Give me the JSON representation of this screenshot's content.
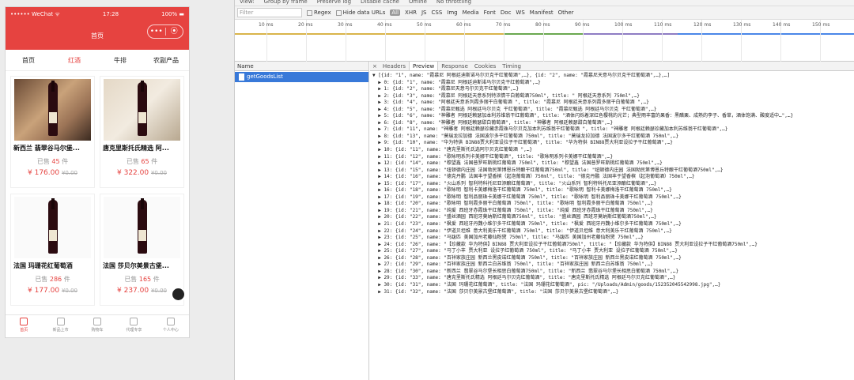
{
  "phone": {
    "status": {
      "carrier": "•••••• WeChat ᯤ",
      "time": "17:28",
      "battery": "100% ▬"
    },
    "title": "首页",
    "capsule": {
      "more": "•••",
      "close": "⦿"
    },
    "tabs": [
      "首页",
      "红酒",
      "牛排",
      "农副产品"
    ],
    "active_tab": 1,
    "products": [
      {
        "name": "新西兰 翡翠谷马尔堡...",
        "sold_prefix": "已售",
        "sold": "45",
        "sold_suffix": "件",
        "price": "¥ 176.00",
        "old": "¥0.00"
      },
      {
        "name": "唐克里斯托氏精选 阿...",
        "sold_prefix": "已售",
        "sold": "65",
        "sold_suffix": "件",
        "price": "¥ 322.00",
        "old": "¥0.00"
      },
      {
        "name": "法国 玛珊花红葡萄酒",
        "sold_prefix": "已售",
        "sold": "286",
        "sold_suffix": "件",
        "price": "¥ 177.00",
        "old": "¥0.00"
      },
      {
        "name": "法国 莎贝尔美景古堡...",
        "sold_prefix": "已售",
        "sold": "165",
        "sold_suffix": "件",
        "price": "¥ 237.00",
        "old": "¥0.00"
      }
    ],
    "tabbar": [
      "首页",
      "新品上市",
      "购物车",
      "代理专享",
      "个人中心"
    ]
  },
  "devtools": {
    "toolbar_top": [
      "View:",
      "Group by frame",
      "Preserve log",
      "Disable cache",
      "Offline",
      "No throttling"
    ],
    "filter_placeholder": "Filter",
    "filters": {
      "regex": "Regex",
      "hide": "Hide data URLs",
      "all": "All",
      "types": [
        "XHR",
        "JS",
        "CSS",
        "Img",
        "Media",
        "Font",
        "Doc",
        "WS",
        "Manifest",
        "Other"
      ]
    },
    "ticks": [
      "10 ms",
      "20 ms",
      "30 ms",
      "40 ms",
      "50 ms",
      "60 ms",
      "70 ms",
      "80 ms",
      "90 ms",
      "100 ms",
      "110 ms",
      "120 ms",
      "130 ms",
      "140 ms",
      "150 ms"
    ],
    "name_header": "Name",
    "request": "getGoodsList",
    "detail_tabs": [
      "×",
      "Headers",
      "Preview",
      "Response",
      "Cookies",
      "Timing"
    ],
    "active_detail": 2,
    "preview_lines": [
      "▼ [{id: \"1\", name: \"霞慕尼 阿根廷迪斯诺马尔贝克干红葡萄酒\",…}, {id: \"2\", name: \"霞慕尼天意马尔贝克干红葡萄酒\",…},…]",
      "  ▶ 0: {id: \"1\", name: \"霞慕尼 阿根廷迪斯诺马尔贝克干红葡萄酒\",…}",
      "  ▶ 1: {id: \"2\", name: \"霞慕尼天意马尔贝克干红葡萄酒\",…}",
      "  ▶ 2: {id: \"3\", name: \"霞慕尼 阿根廷天意系列特浓情干白葡萄酒750ml\", title: \" 阿根廷天意系列 750ml\",…}",
      "  ▶ 3: {id: \"4\", name: \"阿根廷天意系列霞多丽干白葡萄酒 \", title: \"霞慕尼 阿根廷天意系列霞多丽干白葡萄酒 \",…}",
      "  ▶ 4: {id: \"5\", name: \"霞慕尼甄选 阿根廷马尔贝克 干红葡萄酒\", title: \"霞慕尼甄选 阿根廷马尔贝克 干红葡萄酒\",…}",
      "  ▶ 5: {id: \"6\", name: \"神雕者 阿根廷赖瑟加本利苏维翁干红葡萄酒\", title: \"酒体闪烁着深红色樱桃的光芒；典型雨丰富的果香：黑醋栗、成熟的李子、香草，酒体饱满、酸度适中…\",…}",
      "  ▶ 6: {id: \"8\", name: \"神雕者 阿根廷赖瑟甜白葡萄酒\", title: \"神雕者 阿根廷赖瑟甜白葡萄酒\",…}",
      "  ▶ 7: {id: \"11\", name: \"神雕者 阿根廷赖瑟珍藏赤霞珠马尔贝克加本利苏维翁干红葡萄酒 \", title: \"神雕者 阿根廷赖瑟珍藏加本利苏维翁干红葡萄酒\",…}",
      "  ▶ 8: {id: \"13\", name: \"莫瑞龙拉加德 法国波尔多干红葡萄酒 750ml\", title: \"莫瑞龙拉加德 法国波尔多干红葡萄酒 750ml\",…}",
      "  ▶ 9: {id: \"10\", name: \"华为特供 BIN88贾大利亚设拉子干红葡萄酒\", title: \"华为特供 BIN88贾大利亚设拉子干红葡萄酒\",…}",
      "  ▶ 10: {id: \"11\", name: \"唐克里斯托氏选阿尔贝克红葡萄酒 \",…}",
      "  ▶ 11: {id: \"12\", name: \"歌咏明系列卡美娜干红葡萄酒\", title: \"歌咏明系列卡美娜干红葡萄酒\",…}",
      "  ▶ 12: {id: \"14\", name: \"穆望鑫 法国普罗旺斯桃红葡萄酒 750ml\", title: \"穆望鑫 法国普罗旺斯桃红葡萄酒 750ml\",…}",
      "  ▶ 13: {id: \"15\", name: \"纽顿德内庄园 法国勃民第博恩丘特酿干红葡萄酒750ml\", title: \"纽顿德内庄园 法国勃民第博恩丘特酿干红葡萄酒750ml\",…}",
      "  ▶ 14: {id: \"16\", name: \"德克丹鹏 法国丰于望香槟（起泡葡萄酒）750ml\", title: \"德克丹鹏 法国丰于望香槟（起泡葡萄酒）750ml\",…}",
      "  ▶ 15: {id: \"17\", name: \"火山系列 智利特科托尼亚添酿红葡萄酒\", title: \"火山系列 智利特科托尼亚添酿红葡萄酒\",…}",
      "  ▶ 16: {id: \"18\", name: \"歌咏明 智利卡美娜梅洛干红葡萄酒 750ml\", title: \"歌咏明 智利卡美娜梅洛干红葡萄酒 750ml\",…}",
      "  ▶ 17: {id: \"19\", name: \"歌咏明 智利品丽珠卡美娜干红葡萄酒 750ml\", title: \"歌咏明 智利品丽珠卡美娜干红葡萄酒 750ml\",…}",
      "  ▶ 18: {id: \"20\", name: \"歌咏明 智利霞多丽干白葡萄酒 750ml\", title: \"歌咏明 智利霞多丽干白葡萄酒 750ml\",…}",
      "  ▶ 19: {id: \"21\", name: \"纯爱 西班牙赤霞珠干红葡萄酒 750ml\", title: \"纯爱 西班牙赤霞珠干红葡萄酒 750ml\",…}",
      "  ▶ 20: {id: \"22\", name: \"盛丝酒园 西班牙莫纳斯红葡萄酒750ml\", title: \"盛丝酒园 西班牙莫纳斯红葡萄酒750ml\",…}",
      "  ▶ 21: {id: \"23\", name: \"枫爱 西班牙丹魏小维尔多干红葡萄酒 750ml\", title: \"枫爱 西班牙丹魏小维尔多干红葡萄酒 750ml\",…}",
      "  ▶ 22: {id: \"24\", name: \"伊道贝坦维 意大利美乐干红葡萄酒 750ml\", title: \"伊道贝坦维 意大利美乐干红葡萄酒 750ml\",…}",
      "  ▶ 23: {id: \"25\", name: \"马跋匹 美国加州老藤仙粉黛 750ml\", title: \"马跋匹 美国加州老藤仙粉黛 750ml\",…}",
      "  ▶ 24: {id: \"26\", name: \"【珍藏款 华为特供】BIN88 贾大利亚设拉子干红葡萄酒750ml\", title: \"【珍藏款 华为特供】BIN88 贾大利亚设拉子干红葡萄酒750ml\",…}",
      "  ▶ 25: {id: \"27\", name: \"马丁小丰 贾大利亚 设拉子红葡萄酒 750ml\", title: \"马丁小丰 贾大利亚 设拉子红葡萄酒 750ml\",…}",
      "  ▶ 26: {id: \"28\", name: \"百祥家族庄园 新西兰黑皮诺红葡萄酒 750ml\", title: \"百祥家族庄园 新西兰黑皮诺红葡萄酒 750ml\",…}",
      "  ▶ 27: {id: \"29\", name: \"百祥家族庄园 新西兰白苏维翁 750ml\", title: \"百祥家族庄园 新西兰白苏维翁 750ml\",…}",
      "  ▶ 28: {id: \"30\", name: \"新西兰 翡翠谷马尔堡长相思白葡萄酒750ml\", title: \"新西兰 翡翠谷马尔堡长相思白葡萄酒 750ml\",…}",
      "  ▶ 29: {id: \"33\", name: \"唐克里斯托氏精选 阿根廷马尔贝克红葡萄酒\", title: \"唐克里斯托氏精选 阿根廷马尔贝克红葡萄酒\",…}",
      "  ▶ 30: {id: \"31\", name: \"法国 玛珊花红葡萄酒\", title: \"法国 玛珊花红葡萄酒\", pic: \"/Uploads/Admin/goods/152352045542998.jpg\",…}",
      "  ▶ 31: {id: \"32\", name: \"法国 莎贝尔美景古堡红葡萄酒\", title: \"法国 莎贝尔美景古堡红葡萄酒\",…}"
    ]
  }
}
